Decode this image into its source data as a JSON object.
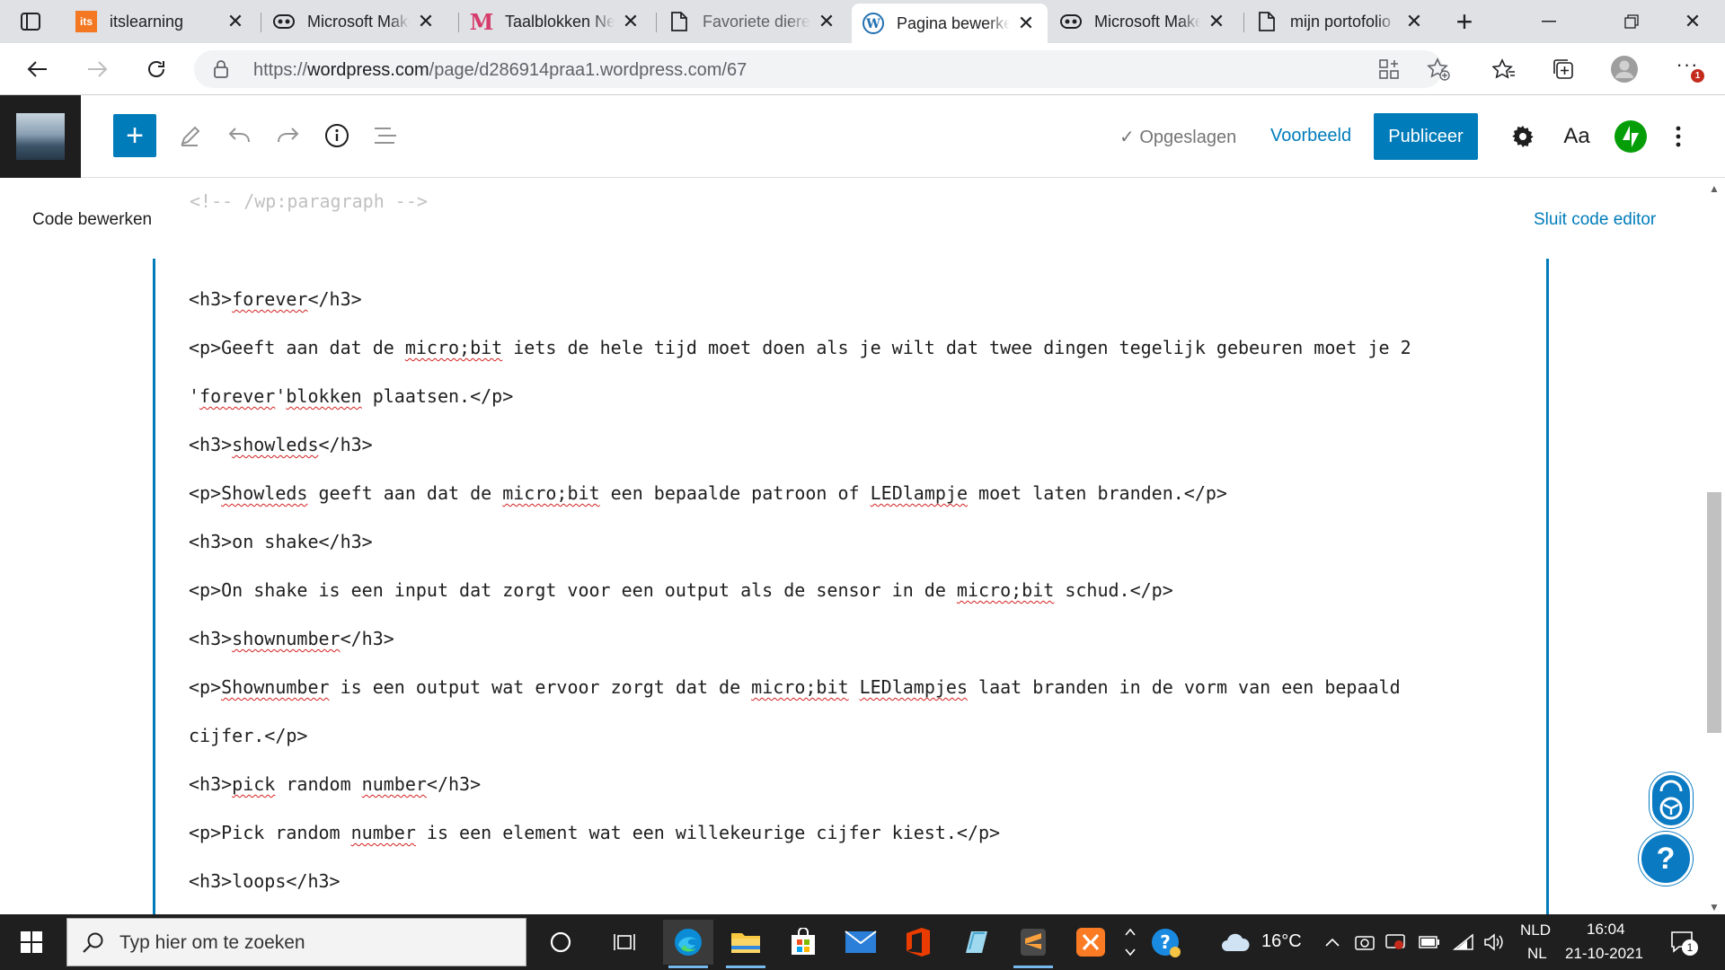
{
  "browser": {
    "tabs": [
      {
        "title": "itslearning"
      },
      {
        "title": "Microsoft MakeCode"
      },
      {
        "title": "Taalblokken Nederlands"
      },
      {
        "title": "Favoriete dieren"
      },
      {
        "title": "Pagina bewerken"
      },
      {
        "title": "Microsoft MakeCode"
      },
      {
        "title": "mijn portofolio"
      }
    ],
    "favicon_itslearning": "its",
    "url_prefix": "https://",
    "url_host": "wordpress.com",
    "url_path": "/page/d286914praa1.wordpress.com/67"
  },
  "wp_header": {
    "saved_label": "Opgeslagen",
    "preview_label": "Voorbeeld",
    "publish_label": "Publiceer",
    "typography_label": "Aa",
    "colors": {
      "accent": "#007cba",
      "jetpack": "#069e08"
    }
  },
  "editor": {
    "code_title": "Code bewerken",
    "close_label": "Sluit code editor",
    "prev_line": "<!-- /wp:paragraph -->",
    "lines": [
      "<h3>forever</h3>",
      "<p>Geeft aan dat de micro;bit iets de hele tijd moet doen als je wilt dat twee dingen tegelijk gebeuren moet je 2",
      "'forever'blokken plaatsen.</p>",
      "<h3>showleds</h3>",
      "<p>Showleds geeft aan dat de micro;bit een bepaalde patroon of LEDlampje moet laten branden.</p>",
      "<h3>on shake</h3>",
      "<p>On shake is een input dat zorgt voor een output als de sensor in de micro;bit schud.</p>",
      "<h3>shownumber</h3>",
      "<p>Shownumber is een output wat ervoor zorgt dat de micro;bit LEDlampjes laat branden in de vorm van een bepaald",
      "cijfer.</p>",
      "<h3>pick random number</h3>",
      "<p>Pick random number is een element wat een willekeurige cijfer kiest.</p>",
      "<h3>loops</h3>"
    ]
  },
  "taskbar": {
    "search_placeholder": "Typ hier om te zoeken",
    "weather": "16°C",
    "lang_top": "NLD",
    "lang_bottom": "NL",
    "time": "16:04",
    "date": "21-10-2021",
    "notification_count": "1",
    "profile_badge": "1"
  }
}
